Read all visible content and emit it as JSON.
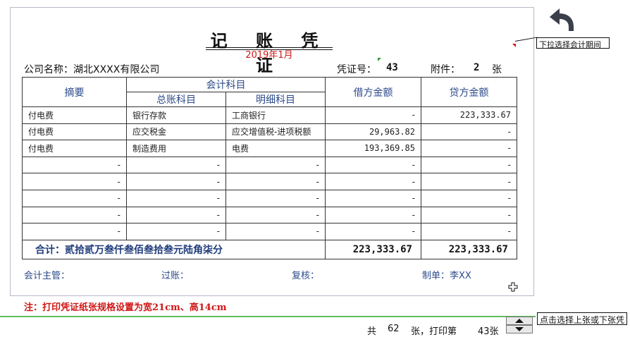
{
  "voucher": {
    "title": "记 账 凭 证",
    "period": "2019年1月",
    "company_label": "公司名称：",
    "company_name": "湖北XXXX有限公司",
    "voucher_no_label": "凭证号：",
    "voucher_no": "43",
    "attachments_label": "附件：",
    "attachments_count": "2",
    "attachments_unit": "张"
  },
  "table": {
    "headers": {
      "summary": "摘要",
      "account": "会计科目",
      "general_account": "总账科目",
      "detail_account": "明细科目",
      "debit": "借方金额",
      "credit": "贷方金额"
    },
    "rows": [
      {
        "summary": "付电费",
        "general": "银行存款",
        "detail": "工商银行",
        "debit": "-",
        "credit": "223,333.67"
      },
      {
        "summary": "付电费",
        "general": "应交税金",
        "detail": "应交增值税-进项税额",
        "debit": "29,963.82",
        "credit": "-"
      },
      {
        "summary": "付电费",
        "general": "制造费用",
        "detail": "电费",
        "debit": "193,369.85",
        "credit": "-"
      },
      {
        "summary": "-",
        "general": "-",
        "detail": "-",
        "debit": "-",
        "credit": "-"
      },
      {
        "summary": "-",
        "general": "-",
        "detail": "-",
        "debit": "-",
        "credit": "-"
      },
      {
        "summary": "-",
        "general": "-",
        "detail": "-",
        "debit": "-",
        "credit": "-"
      },
      {
        "summary": "-",
        "general": "-",
        "detail": "-",
        "debit": "-",
        "credit": "-"
      },
      {
        "summary": "-",
        "general": "-",
        "detail": "-",
        "debit": "-",
        "credit": "-"
      }
    ],
    "total_label": "合计：贰拾贰万叁仟叁佰叁拾叁元陆角柒分",
    "total_debit": "223,333.67",
    "total_credit": "223,333.67"
  },
  "signatures": {
    "supervisor": "会计主管：",
    "posting": "过账：",
    "review": "复核：",
    "preparer": "制单：李XX"
  },
  "note": "注：打印凭证纸张规格设置为宽21cm、高14cm",
  "footer": {
    "total_prefix": "共",
    "total_count": "62",
    "print_label": "张，打印第",
    "current": "43张"
  },
  "comments": {
    "period_hint": "下拉选择会计期间",
    "nav_hint": "点击选择上张或下张凭"
  },
  "icons": {
    "back": "back-arrow-icon",
    "spinner": "spinner-icon",
    "cursor": "cross-cursor-icon"
  }
}
